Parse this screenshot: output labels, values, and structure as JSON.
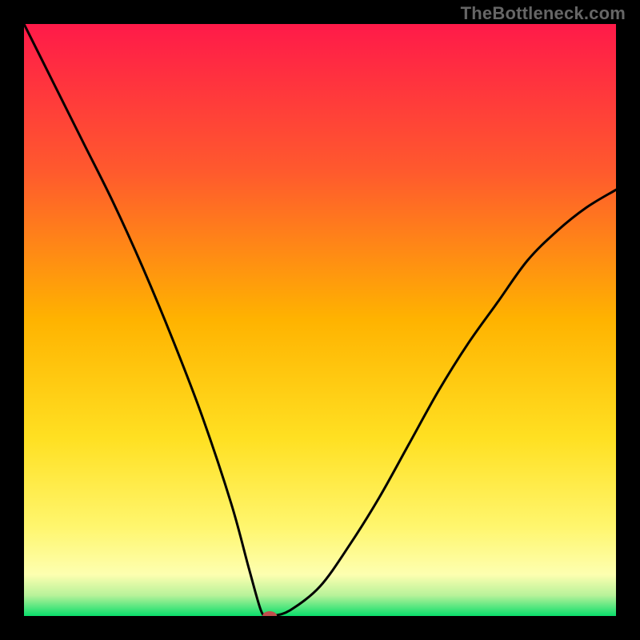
{
  "watermark": "TheBottleneck.com",
  "chart_data": {
    "type": "line",
    "title": "",
    "xlabel": "",
    "ylabel": "",
    "xlim": [
      0,
      100
    ],
    "ylim": [
      0,
      100
    ],
    "grid": false,
    "series": [
      {
        "name": "bottleneck-curve",
        "x": [
          0,
          5,
          10,
          15,
          20,
          25,
          30,
          35,
          38,
          40,
          41,
          42,
          45,
          50,
          55,
          60,
          65,
          70,
          75,
          80,
          85,
          90,
          95,
          100
        ],
        "values": [
          100,
          90,
          80,
          70,
          59,
          47,
          34,
          19,
          8,
          1,
          0,
          0,
          1,
          5,
          12,
          20,
          29,
          38,
          46,
          53,
          60,
          65,
          69,
          72
        ]
      }
    ],
    "optimum": {
      "x": 41.5,
      "y": 0
    },
    "gradient_stops": [
      {
        "offset": 0,
        "color": "#ff1a49"
      },
      {
        "offset": 0.25,
        "color": "#ff5a2d"
      },
      {
        "offset": 0.5,
        "color": "#ffb300"
      },
      {
        "offset": 0.7,
        "color": "#ffe022"
      },
      {
        "offset": 0.85,
        "color": "#fff66e"
      },
      {
        "offset": 0.93,
        "color": "#fdffb0"
      },
      {
        "offset": 0.965,
        "color": "#b8f29a"
      },
      {
        "offset": 1.0,
        "color": "#0ade6b"
      }
    ]
  }
}
